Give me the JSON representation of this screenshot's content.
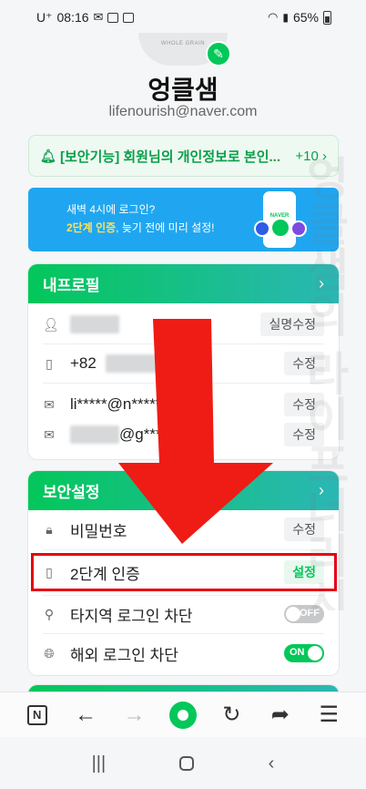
{
  "status_bar": {
    "carrier": "U⁺",
    "time": "08:16",
    "battery": "65%"
  },
  "profile": {
    "avatar_text": "WHOLE GRAIN",
    "name": "엉클샘",
    "email": "lifenourish@naver.com"
  },
  "notice": {
    "text": "[보안기능] 회원님의 개인정보로 본인...",
    "count": "+10"
  },
  "banner": {
    "line1": "새벽 4시에 로그인?",
    "line2_highlight": "2단계 인증",
    "line2_rest": ", 늦기 전에 미리 설정!",
    "phone_label": "NAVER"
  },
  "my_profile": {
    "title": "내프로필",
    "rows": [
      {
        "value": "",
        "button": "실명수정"
      },
      {
        "value": "+82",
        "button": "수정"
      },
      {
        "value": "li*****@n*******.com",
        "button": "수정"
      },
      {
        "value": "@g****.com",
        "button": "수정"
      }
    ]
  },
  "security": {
    "title": "보안설정",
    "password": {
      "label": "비밀번호",
      "button": "수정"
    },
    "two_factor": {
      "label": "2단계 인증",
      "button": "설정"
    },
    "region_block": {
      "label": "타지역 로그인 차단",
      "toggle": "OFF"
    },
    "overseas_block": {
      "label": "해외 로그인 차단",
      "toggle": "ON"
    }
  },
  "watermark": "엉클샘의 라이프너리시",
  "colors": {
    "brand_green": "#03c75a",
    "banner_blue": "#20a6f0",
    "annotation_red": "#e60012"
  }
}
